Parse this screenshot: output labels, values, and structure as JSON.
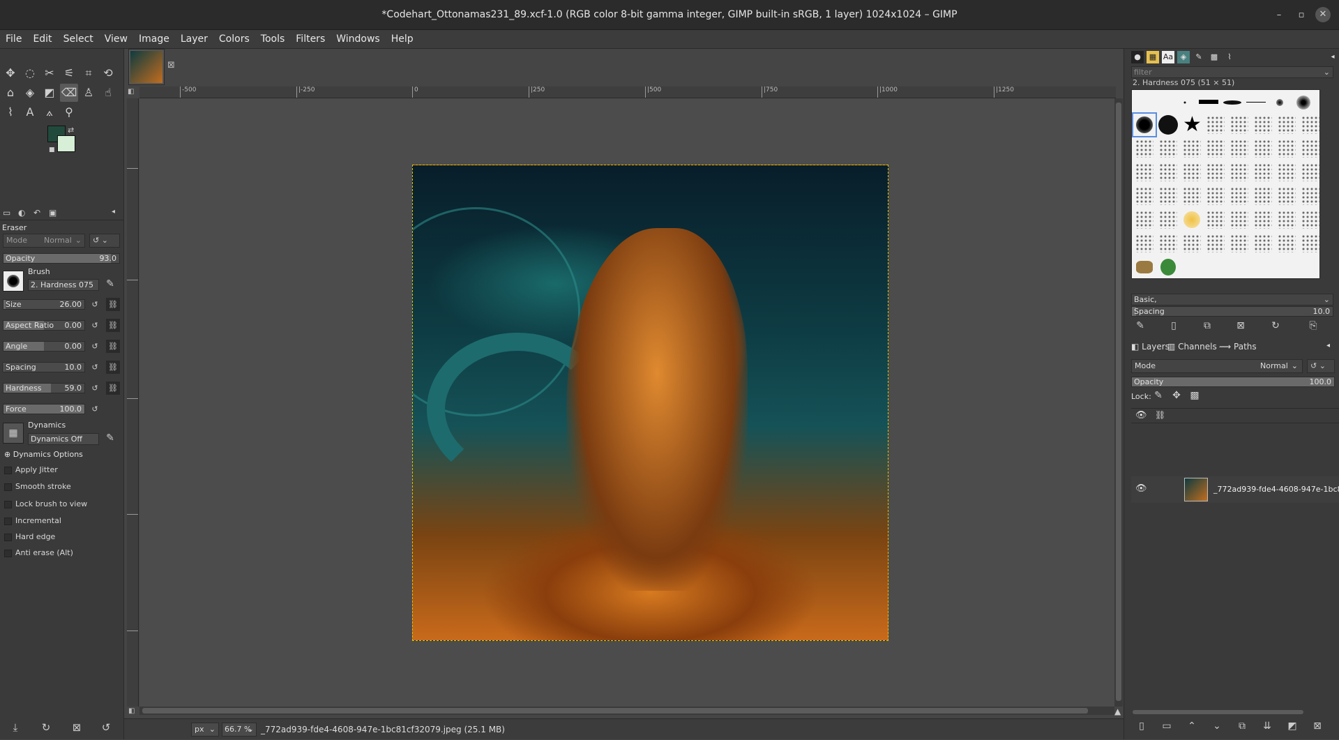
{
  "window": {
    "title": "*Codehart_Ottonamas231_89.xcf-1.0 (RGB color 8-bit gamma integer, GIMP built-in sRGB, 1 layer) 1024x1024 – GIMP",
    "minimize": "–",
    "maximize": "▫",
    "close": "✕"
  },
  "menu": [
    "File",
    "Edit",
    "Select",
    "View",
    "Image",
    "Layer",
    "Colors",
    "Tools",
    "Filters",
    "Windows",
    "Help"
  ],
  "colors": {
    "foreground": "#224a3c",
    "background": "#d6efd6"
  },
  "tool_options": {
    "title": "Eraser",
    "mode_label": "Mode",
    "mode_value": "Normal",
    "opacity_label": "Opacity",
    "opacity_value": "93.0",
    "brush_label": "Brush",
    "brush_value": "2. Hardness 075",
    "size_label": "Size",
    "size_value": "26.00",
    "aspect_label": "Aspect Ratio",
    "aspect_value": "0.00",
    "angle_label": "Angle",
    "angle_value": "0.00",
    "spacing_label": "Spacing",
    "spacing_value": "10.0",
    "hardness_label": "Hardness",
    "hardness_value": "59.0",
    "force_label": "Force",
    "force_value": "100.0",
    "dynamics_label": "Dynamics",
    "dynamics_value": "Dynamics Off",
    "dynamics_options": "Dynamics Options",
    "options": [
      "Apply Jitter",
      "Smooth stroke",
      "Lock brush to view",
      "Incremental",
      "Hard edge",
      "Anti erase  (Alt)"
    ]
  },
  "ruler": {
    "h_ticks": [
      "-500",
      "|-250",
      "0",
      "|250",
      "|500",
      "|750",
      "|1000",
      "|1250"
    ]
  },
  "statusbar": {
    "unit": "px",
    "zoom": "66.7 %",
    "message": "_772ad939-fde4-4608-947e-1bc81cf32079.jpeg (25.1 MB)"
  },
  "brushes": {
    "filter_placeholder": "filter",
    "selected_name": "2. Hardness 075 (51 × 51)",
    "preset": "Basic,",
    "spacing_label": "Spacing",
    "spacing_value": "10.0"
  },
  "layers": {
    "tabs": [
      "Layers",
      "Channels",
      "Paths"
    ],
    "mode_label": "Mode",
    "mode_value": "Normal",
    "opacity_label": "Opacity",
    "opacity_value": "100.0",
    "lock_label": "Lock:",
    "layer_name": "_772ad939-fde4-4608-947e-1bc81cf"
  }
}
